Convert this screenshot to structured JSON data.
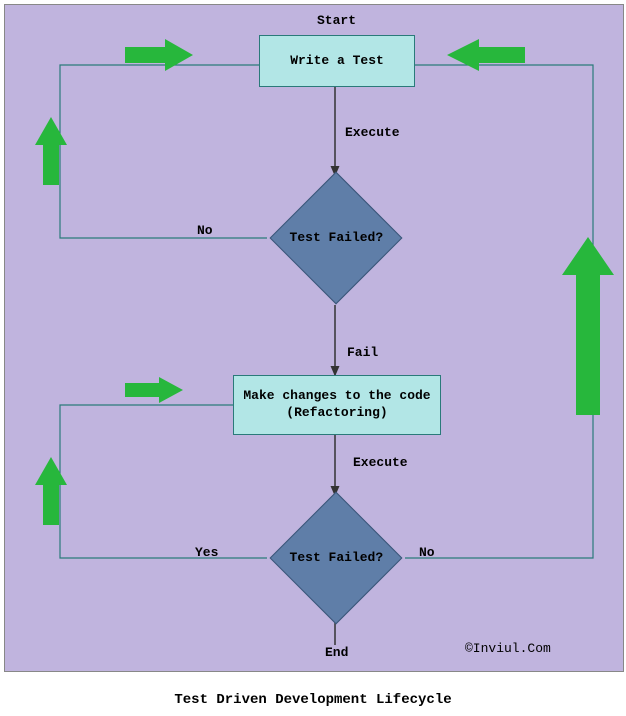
{
  "diagram": {
    "start": "Start",
    "write_test": "Write a Test",
    "exec1": "Execute",
    "decision1": "Test Failed?",
    "no1": "No",
    "fail": "Fail",
    "refactor_line1": "Make changes to the code",
    "refactor_line2": "(Refactoring)",
    "exec2": "Execute",
    "decision2": "Test Failed?",
    "yes2": "Yes",
    "no2": "No",
    "end": "End",
    "credit": "©Inviul.Com",
    "title": "Test Driven Development Lifecycle"
  }
}
